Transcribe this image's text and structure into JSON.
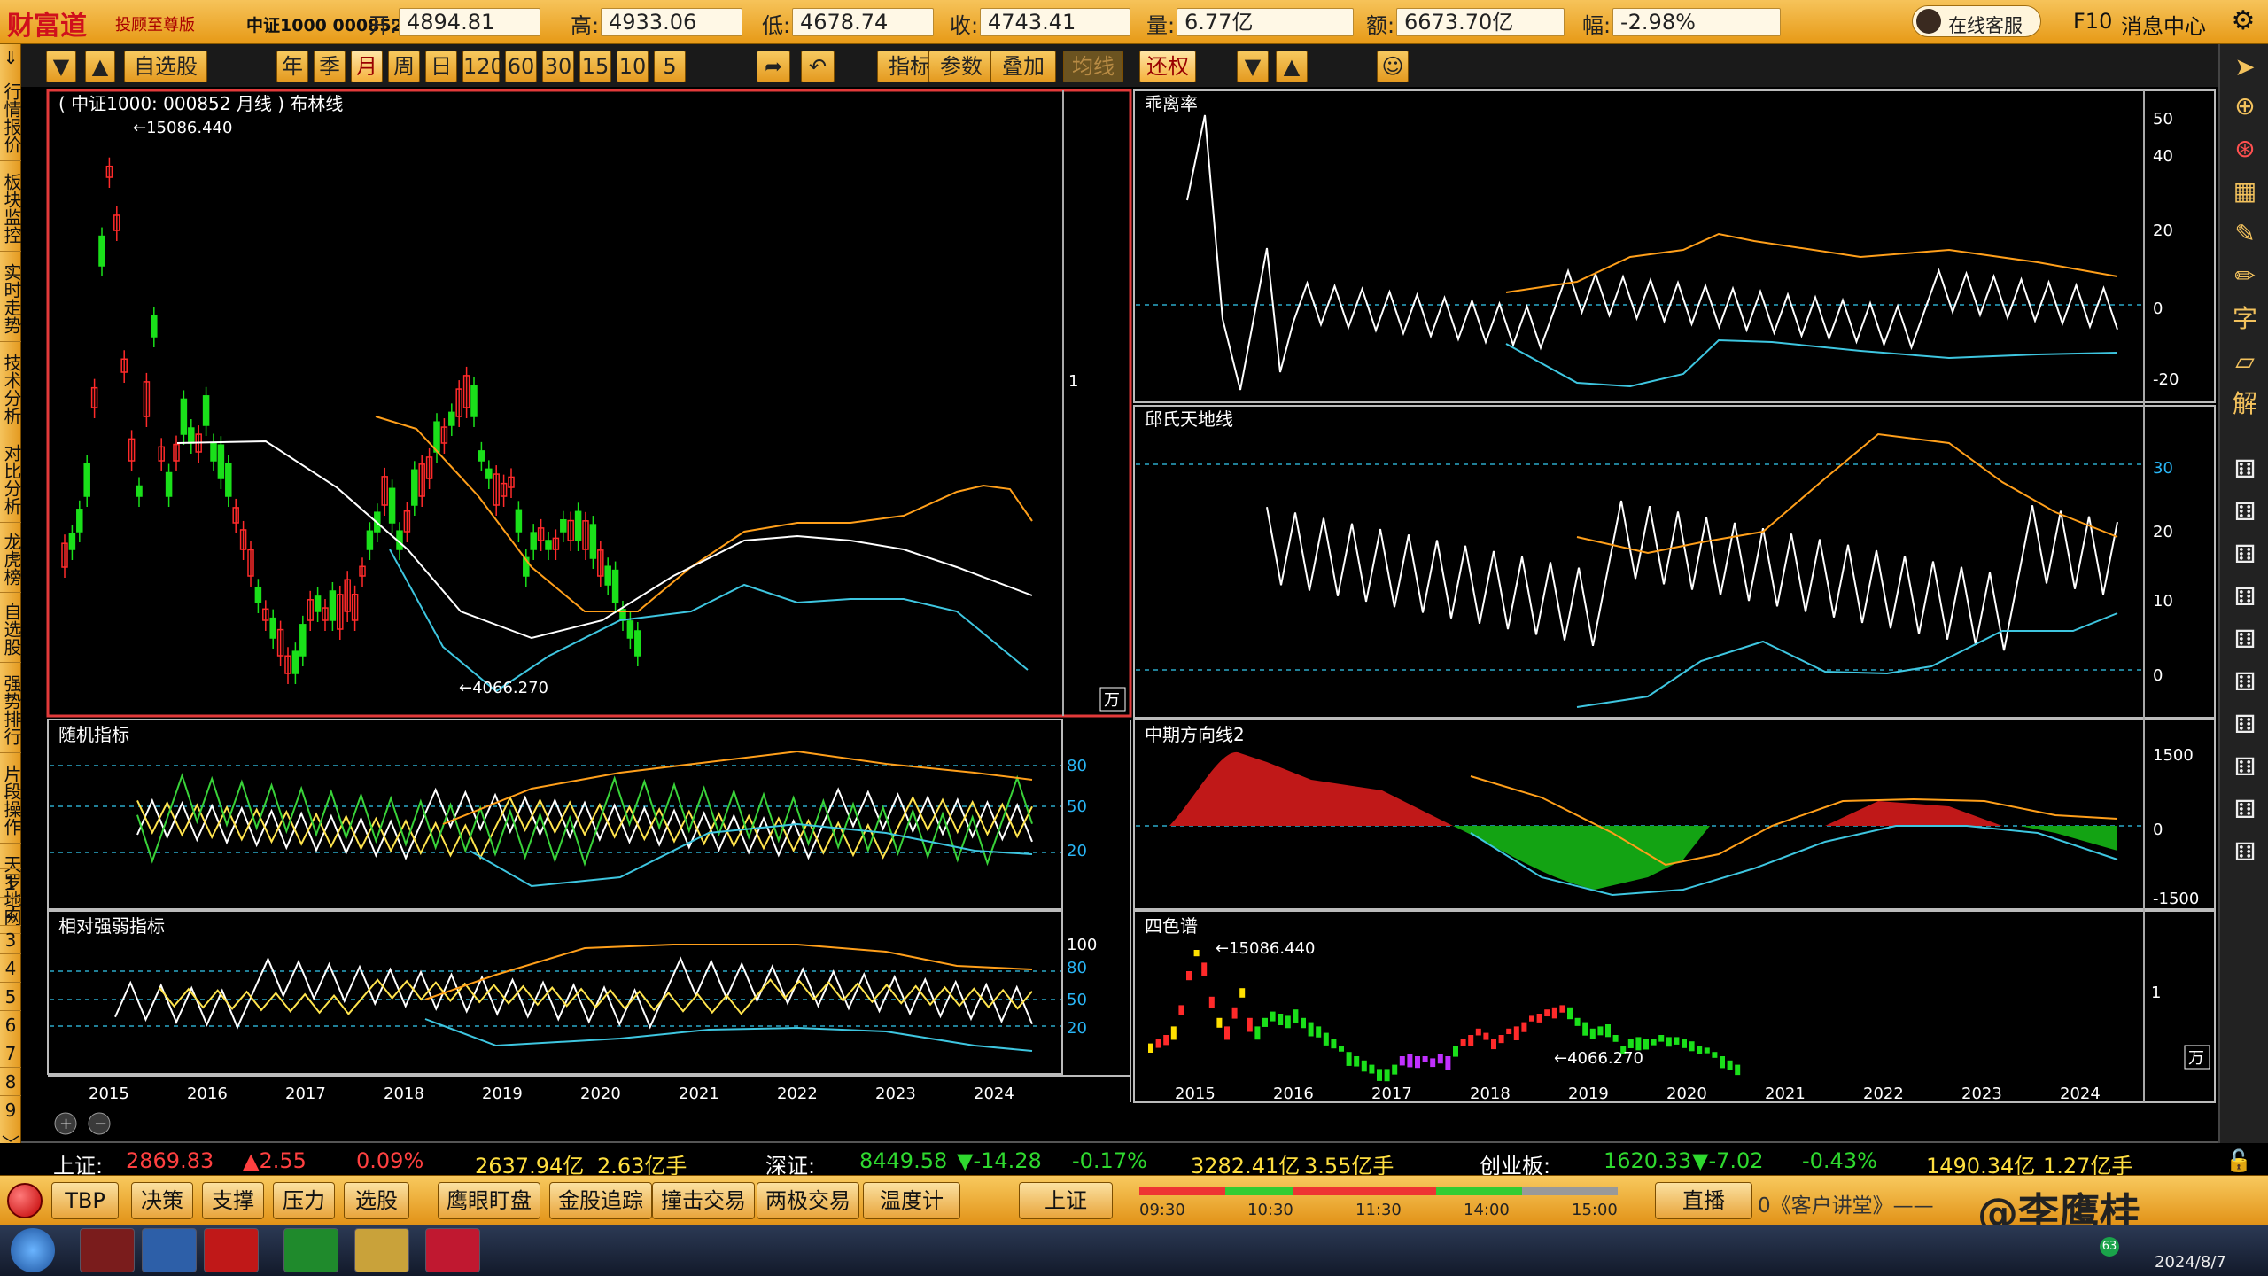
{
  "topbar": {
    "logo": "财富道",
    "slogan": "投顾至尊版",
    "index_name": "中证1000 000852",
    "quotes": [
      {
        "label": "开:",
        "value": "4894.81"
      },
      {
        "label": "高:",
        "value": "4933.06"
      },
      {
        "label": "低:",
        "value": "4678.74"
      },
      {
        "label": "收:",
        "value": "4743.41"
      },
      {
        "label": "量:",
        "value": "6.77亿"
      },
      {
        "label": "额:",
        "value": "6673.70亿"
      },
      {
        "label": "幅:",
        "value": "-2.98%"
      }
    ],
    "online_service": "在线客服",
    "f10": "F10",
    "msg_center": "消息中心"
  },
  "toolbar": {
    "self_select": "自选股",
    "periods": [
      "年",
      "季",
      "月",
      "周",
      "日",
      "120",
      "60",
      "30",
      "15",
      "10",
      "5"
    ],
    "active_period": "月",
    "buttons": [
      "指标",
      "参数",
      "叠加",
      "均线",
      "还权"
    ]
  },
  "leftnav": {
    "items": [
      "行情报价",
      "板块监控",
      "实时走势",
      "技术分析",
      "对比分析",
      "龙虎榜",
      "自选股",
      "强势排行",
      "片段操作",
      "天罗地网"
    ],
    "numbers": [
      "1",
      "2",
      "3",
      "4",
      "5",
      "6",
      "7",
      "8",
      "9"
    ]
  },
  "main_chart": {
    "title": "( 中证1000: 000852 月线 ) 布林线",
    "high_label": "15086.440",
    "low_label": "4066.270",
    "axis_tick": "1",
    "unit": "万"
  },
  "kdj": {
    "title": "随机指标",
    "ticks": [
      "80",
      "50",
      "20"
    ]
  },
  "rsi": {
    "title": "相对强弱指标",
    "ticks": [
      "100",
      "80",
      "50",
      "20"
    ]
  },
  "bias": {
    "title": "乖离率",
    "ticks": [
      "50",
      "40",
      "20",
      "0",
      "-20"
    ]
  },
  "qiu": {
    "title": "邱氏天地线",
    "ticks": [
      "30",
      "20",
      "10",
      "0"
    ]
  },
  "mid": {
    "title": "中期方向线2",
    "ticks": [
      "1500",
      "0",
      "-1500"
    ]
  },
  "four": {
    "title": "四色谱",
    "high_label": "15086.440",
    "low_label": "4066.270",
    "axis_tick": "1",
    "unit": "万"
  },
  "years": [
    "2015",
    "2016",
    "2017",
    "2018",
    "2019",
    "2020",
    "2021",
    "2022",
    "2023",
    "2024"
  ],
  "status": {
    "sh_label": "上证:",
    "sh_val": "2869.83",
    "sh_chg": "▲2.55",
    "sh_pct": "0.09%",
    "sh_amt": "2637.94亿",
    "sh_vol": "2.63亿手",
    "sz_label": "深证:",
    "sz_val": "8449.58",
    "sz_chg": "▼-14.28",
    "sz_pct": "-0.17%",
    "sz_amt": "3282.41亿",
    "sz_vol": "3.55亿手",
    "cy_label": "创业板:",
    "cy_val": "1620.33",
    "cy_chg": "▼-7.02",
    "cy_pct": "-0.43%",
    "cy_amt": "1490.34亿",
    "cy_vol": "1.27亿手"
  },
  "bottombar": {
    "buttons": [
      "TBP",
      "决策",
      "支撑",
      "压力",
      "选股",
      "鹰眼盯盘",
      "金股追踪",
      "撞击交易",
      "两极交易",
      "温度计"
    ],
    "market": "上证",
    "times": [
      "09:30",
      "10:30",
      "11:30",
      "14:00",
      "15:00"
    ],
    "live": "直播",
    "ticker": "0《客户讲堂》——",
    "watermark": "@李鹰桂"
  },
  "taskbar": {
    "date": "2024/8/7",
    "badge": "63"
  }
}
